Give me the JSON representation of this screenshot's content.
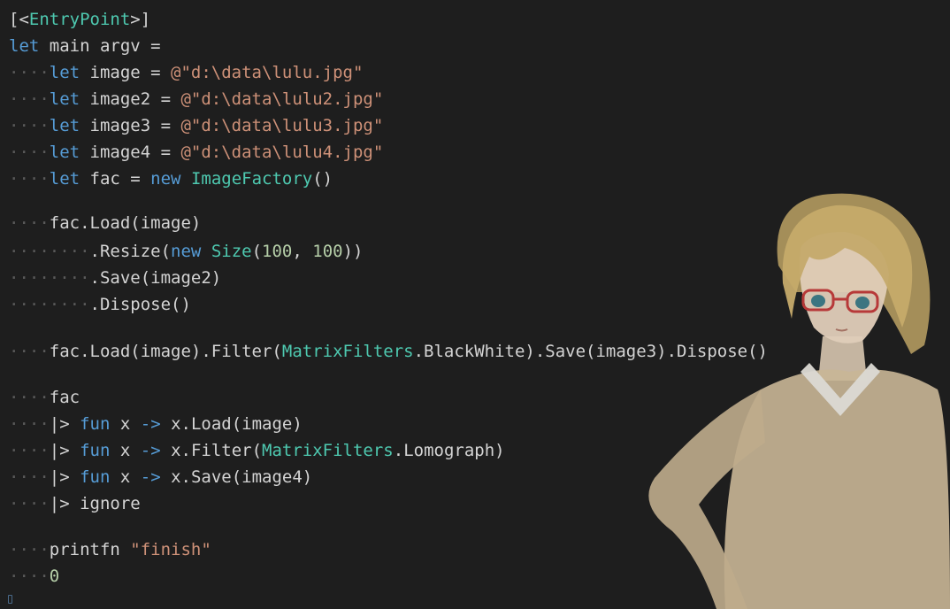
{
  "editor": {
    "theme_colors": {
      "background": "#1e1e1e",
      "keyword": "#569cd6",
      "string": "#ce9178",
      "number": "#b5cea8",
      "type": "#4ec9b0",
      "text": "#d4d4d4",
      "whitespace_marker": "#5a5a5a"
    },
    "background_image": "anime-girl-glasses-illustration",
    "lines": [
      [
        [
          "pl",
          "[<"
        ],
        [
          "ty",
          "EntryPoint"
        ],
        [
          "pl",
          ">]"
        ]
      ],
      [
        [
          "kw",
          "let"
        ],
        [
          "pl",
          " main argv ="
        ]
      ],
      [
        [
          "ind",
          "····"
        ],
        [
          "kw",
          "let"
        ],
        [
          "pl",
          " image = "
        ],
        [
          "str",
          "@\"d:\\data\\lulu.jpg\""
        ]
      ],
      [
        [
          "ind",
          "····"
        ],
        [
          "kw",
          "let"
        ],
        [
          "pl",
          " image2 = "
        ],
        [
          "str",
          "@\"d:\\data\\lulu2.jpg\""
        ]
      ],
      [
        [
          "ind",
          "····"
        ],
        [
          "kw",
          "let"
        ],
        [
          "pl",
          " image3 = "
        ],
        [
          "str",
          "@\"d:\\data\\lulu3.jpg\""
        ]
      ],
      [
        [
          "ind",
          "····"
        ],
        [
          "kw",
          "let"
        ],
        [
          "pl",
          " image4 = "
        ],
        [
          "str",
          "@\"d:\\data\\lulu4.jpg\""
        ]
      ],
      [
        [
          "ind",
          "····"
        ],
        [
          "kw",
          "let"
        ],
        [
          "pl",
          " fac = "
        ],
        [
          "kw",
          "new"
        ],
        [
          "pl",
          " "
        ],
        [
          "ty",
          "ImageFactory"
        ],
        [
          "pl",
          "()"
        ]
      ],
      [
        [
          "ind",
          "····"
        ],
        [
          "pl",
          "fac.Load(image)"
        ]
      ],
      [
        [
          "ind",
          "········"
        ],
        [
          "pl",
          ".Resize("
        ],
        [
          "kw",
          "new"
        ],
        [
          "pl",
          " "
        ],
        [
          "ty",
          "Size"
        ],
        [
          "pl",
          "("
        ],
        [
          "num",
          "100"
        ],
        [
          "pl",
          ", "
        ],
        [
          "num",
          "100"
        ],
        [
          "pl",
          "))"
        ]
      ],
      [
        [
          "ind",
          "········"
        ],
        [
          "pl",
          ".Save(image2)"
        ]
      ],
      [
        [
          "ind",
          "········"
        ],
        [
          "pl",
          ".Dispose()"
        ]
      ],
      [
        [
          "ind",
          "····"
        ],
        [
          "pl",
          "fac.Load(image).Filter("
        ],
        [
          "ty",
          "MatrixFilters"
        ],
        [
          "pl",
          ".BlackWhite).Save(image3).Dispose()"
        ]
      ],
      [
        [
          "ind",
          "····"
        ],
        [
          "pl",
          "fac"
        ]
      ],
      [
        [
          "ind",
          "····"
        ],
        [
          "pl",
          "|> "
        ],
        [
          "kw",
          "fun"
        ],
        [
          "pl",
          " x "
        ],
        [
          "kw",
          "->"
        ],
        [
          "pl",
          " x.Load(image)"
        ]
      ],
      [
        [
          "ind",
          "····"
        ],
        [
          "pl",
          "|> "
        ],
        [
          "kw",
          "fun"
        ],
        [
          "pl",
          " x "
        ],
        [
          "kw",
          "->"
        ],
        [
          "pl",
          " x.Filter("
        ],
        [
          "ty",
          "MatrixFilters"
        ],
        [
          "pl",
          ".Lomograph)"
        ]
      ],
      [
        [
          "ind",
          "····"
        ],
        [
          "pl",
          "|> "
        ],
        [
          "kw",
          "fun"
        ],
        [
          "pl",
          " x "
        ],
        [
          "kw",
          "->"
        ],
        [
          "pl",
          " x.Save(image4)"
        ]
      ],
      [
        [
          "ind",
          "····"
        ],
        [
          "pl",
          "|> ignore"
        ]
      ],
      [
        [
          "ind",
          "····"
        ],
        [
          "pl",
          "printfn "
        ],
        [
          "str",
          "\"finish\""
        ]
      ],
      [
        [
          "ind",
          "····"
        ],
        [
          "num",
          "0"
        ]
      ]
    ]
  }
}
